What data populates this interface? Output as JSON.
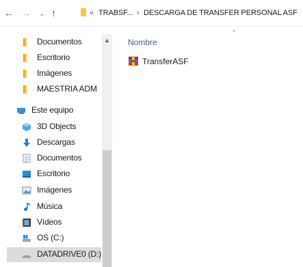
{
  "address_bar": {
    "back_icon": "←",
    "forward_icon": "→",
    "dropdown_icon": "⌄",
    "up_icon": "↑",
    "overflow_chevron": "«",
    "breadcrumbs": [
      "TRABSF...",
      "DESCARGA DE TRANSFER PERSONAL ASF"
    ],
    "separator": "›"
  },
  "sidebar": {
    "items": [
      {
        "label": "Documentos",
        "icon": "folder-icon"
      },
      {
        "label": "Escritorio",
        "icon": "folder-icon"
      },
      {
        "label": "Imágenes",
        "icon": "folder-icon"
      },
      {
        "label": "MAESTRIA ADM",
        "icon": "folder-icon"
      },
      {
        "label": "Este equipo",
        "icon": "pc-icon"
      },
      {
        "label": "3D Objects",
        "icon": "cube-icon"
      },
      {
        "label": "Descargas",
        "icon": "download-icon"
      },
      {
        "label": "Documentos",
        "icon": "document-icon"
      },
      {
        "label": "Escritorio",
        "icon": "desktop-icon"
      },
      {
        "label": "Imágenes",
        "icon": "pictures-icon"
      },
      {
        "label": "Música",
        "icon": "music-icon"
      },
      {
        "label": "Vídeos",
        "icon": "video-icon"
      },
      {
        "label": "OS (C:)",
        "icon": "drive-icon"
      },
      {
        "label": "DATADRIVE0 (D:)",
        "icon": "drive-icon",
        "selected": true
      }
    ]
  },
  "list": {
    "column_header": "Nombre",
    "sort_indicator": "^",
    "files": [
      {
        "name": "TransferASF",
        "icon": "winrar-archive-icon"
      }
    ]
  },
  "colors": {
    "folder": "#f3c64a",
    "selected_bg": "#dcdcdc",
    "header_text": "#4c607a",
    "accent_blue": "#1e90d6"
  }
}
